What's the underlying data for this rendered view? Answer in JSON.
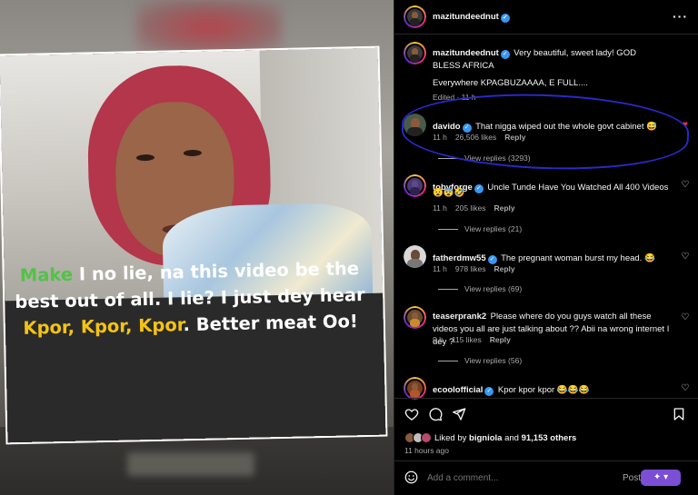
{
  "media": {
    "caption": {
      "w1": "Make",
      "w2": " I no lie, na this video be the best out of all. I lie? I just dey hear ",
      "w3": "Kpor, Kpor, Kpor",
      "w4": ". Better meat Oo!"
    },
    "colors": {
      "green": "#53c248",
      "yellow": "#f4c312"
    }
  },
  "header": {
    "username": "mazitundeednut",
    "more_icon": "more-horizontal-icon"
  },
  "caption_comment": {
    "username": "mazitundeednut",
    "text": "Very beautiful, sweet lady! GOD BLESS AFRICA",
    "text2": "Everywhere KPAGBUZAAAA, E FULL....",
    "meta": "Edited · 11 h"
  },
  "comments": [
    {
      "username": "davido",
      "text": "That nigga wiped out the whole govt cabinet 😅",
      "time": "11 h",
      "likes": "26,506 likes",
      "reply": "Reply",
      "view_replies": "View replies (3293)",
      "liked": true
    },
    {
      "username": "tobyforge",
      "text": "Uncle Tunde Have You Watched All 400 Videos",
      "text2": "😧😨🤣",
      "time": "11 h",
      "likes": "205 likes",
      "reply": "Reply",
      "view_replies": "View replies (21)",
      "liked": false
    },
    {
      "username": "fatherdmw55",
      "text": "The pregnant woman burst my head. 😂",
      "time": "11 h",
      "likes": "978 likes",
      "reply": "Reply",
      "view_replies": "View replies (69)",
      "liked": false
    },
    {
      "username": "teaserprank2",
      "text": "Please where do you guys watch all these videos you all are just talking about ?? Abii na wrong internet I dey ?",
      "time": "9 h",
      "likes": "115 likes",
      "reply": "Reply",
      "view_replies": "View replies (56)",
      "liked": false
    },
    {
      "username": "ecoolofficial",
      "text": "Kpor kpor kpor 😂😂😂",
      "time": "",
      "likes": "",
      "reply": "",
      "view_replies": "",
      "liked": false
    }
  ],
  "actions": {
    "like_icon": "heart-icon",
    "comment_icon": "comment-icon",
    "share_icon": "send-icon",
    "save_icon": "bookmark-icon"
  },
  "likes_summary": {
    "prefix": "Liked by ",
    "user": "bigniola",
    "suffix": " and ",
    "others": "91,153 others",
    "time": "11 hours ago"
  },
  "composer": {
    "placeholder": "Add a comment...",
    "post_label": "Post",
    "emoji_icon": "smiley-icon"
  }
}
